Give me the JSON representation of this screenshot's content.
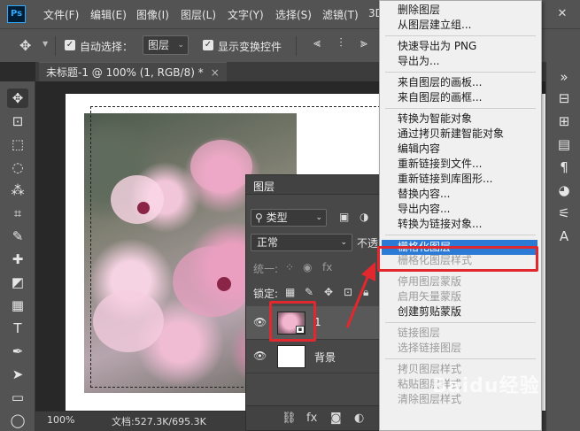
{
  "app": {
    "logo": "Ps"
  },
  "menubar": {
    "items": [
      "文件(F)",
      "编辑(E)",
      "图像(I)",
      "图层(L)",
      "文字(Y)",
      "选择(S)",
      "滤镜(T)",
      "3D"
    ],
    "window_controls": [
      "minimize-icon",
      "restore-icon",
      "close-icon"
    ]
  },
  "options": {
    "auto_select_label": "自动选择：",
    "auto_select_target": "图层",
    "show_transform_label": "显示变换控件"
  },
  "document_tab": {
    "title": "未标题-1 @ 100% (1, RGB/8) *",
    "close": "×"
  },
  "status": {
    "zoom": "100%",
    "doc_info": "文档:527.3K/695.3K"
  },
  "layers_panel": {
    "title": "图层",
    "filter_kind": "类型",
    "blend_mode": "正常",
    "opacity_label": "不透",
    "unify_label": "统一:",
    "lock_label": "锁定:",
    "layers": [
      {
        "name": "1",
        "smart_object": true,
        "selected": true
      },
      {
        "name": "背景",
        "smart_object": false,
        "selected": false
      }
    ]
  },
  "context_menu": {
    "items": [
      {
        "label": "删除图层",
        "enabled": true
      },
      {
        "label": "从图层建立组...",
        "enabled": true
      },
      {
        "sep": true
      },
      {
        "label": "快速导出为 PNG",
        "enabled": true
      },
      {
        "label": "导出为...",
        "enabled": true
      },
      {
        "sep": true
      },
      {
        "label": "来自图层的画板...",
        "enabled": true
      },
      {
        "label": "来自图层的画框...",
        "enabled": true
      },
      {
        "sep": true
      },
      {
        "label": "转换为智能对象",
        "enabled": true
      },
      {
        "label": "通过拷贝新建智能对象",
        "enabled": true
      },
      {
        "label": "编辑内容",
        "enabled": true
      },
      {
        "label": "重新链接到文件...",
        "enabled": true
      },
      {
        "label": "重新链接到库图形...",
        "enabled": true
      },
      {
        "label": "替换内容...",
        "enabled": true
      },
      {
        "label": "导出内容...",
        "enabled": true
      },
      {
        "label": "转换为链接对象...",
        "enabled": true
      },
      {
        "sep": true
      },
      {
        "label": "栅格化图层",
        "enabled": true,
        "highlighted": true
      },
      {
        "label": "栅格化图层样式",
        "enabled": false
      },
      {
        "sep": true
      },
      {
        "label": "停用图层蒙版",
        "enabled": false
      },
      {
        "label": "启用矢量蒙版",
        "enabled": false
      },
      {
        "label": "创建剪贴蒙版",
        "enabled": true
      },
      {
        "sep": true
      },
      {
        "label": "链接图层",
        "enabled": false
      },
      {
        "label": "选择链接图层",
        "enabled": false
      },
      {
        "sep": true
      },
      {
        "label": "拷贝图层样式",
        "enabled": false
      },
      {
        "label": "粘贴图层样式",
        "enabled": false
      },
      {
        "label": "清除图层样式",
        "enabled": false
      }
    ]
  },
  "watermark": "Baidu经验",
  "colors": {
    "highlight": "#2b7ad6",
    "annotation_red": "#e0282e",
    "ps_blue": "#31a8ff"
  }
}
